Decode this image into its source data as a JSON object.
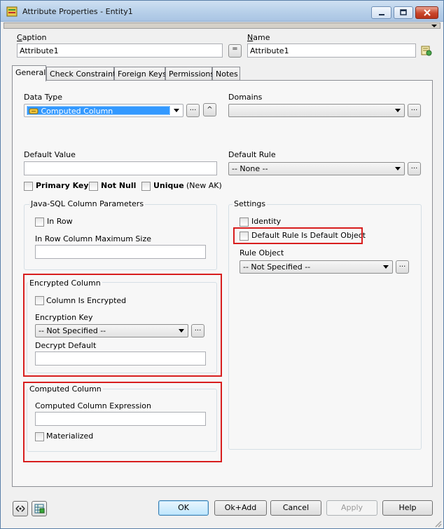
{
  "window": {
    "title": "Attribute Properties - Entity1"
  },
  "header": {
    "caption_label": "Caption",
    "caption_value": "Attribute1",
    "equals_label": "=",
    "name_label": "Name",
    "name_value": "Attribute1"
  },
  "tabs": [
    {
      "label": "General"
    },
    {
      "label": "Check Constraints"
    },
    {
      "label": "Foreign Keys"
    },
    {
      "label": "Permissions"
    },
    {
      "label": "Notes"
    }
  ],
  "general": {
    "data_type_label": "Data Type",
    "data_type_value": "Computed Column",
    "ellipsis": "...",
    "up_glyph": "^",
    "domains_label": "Domains",
    "domains_value": "",
    "default_value_label": "Default Value",
    "default_value": "",
    "default_rule_label": "Default Rule",
    "default_rule_value": "-- None --",
    "primary_key_label": "Primary Key",
    "not_null_label": "Not Null",
    "unique_label": "Unique",
    "new_ak_label": "(New AK)",
    "java_sql": {
      "title": "Java-SQL Column Parameters",
      "in_row_label": "In Row",
      "max_size_label": "In Row Column Maximum Size",
      "max_size_value": ""
    },
    "settings": {
      "title": "Settings",
      "identity_label": "Identity",
      "default_rule_object_label": "Default Rule Is Default Object",
      "rule_object_label": "Rule Object",
      "rule_object_value": "-- Not Specified --"
    },
    "encrypted": {
      "title": "Encrypted Column",
      "is_encrypted_label": "Column Is Encrypted",
      "encryption_key_label": "Encryption Key",
      "encryption_key_value": "-- Not Specified --",
      "decrypt_default_label": "Decrypt Default",
      "decrypt_default_value": ""
    },
    "computed": {
      "title": "Computed Column",
      "expression_label": "Computed Column Expression",
      "expression_value": "",
      "materialized_label": "Materialized"
    }
  },
  "footer": {
    "ok": "OK",
    "ok_add": "Ok+Add",
    "cancel": "Cancel",
    "apply": "Apply",
    "help": "Help"
  },
  "colors": {
    "highlight_border": "#d81e1e",
    "selection": "#3399ff"
  }
}
